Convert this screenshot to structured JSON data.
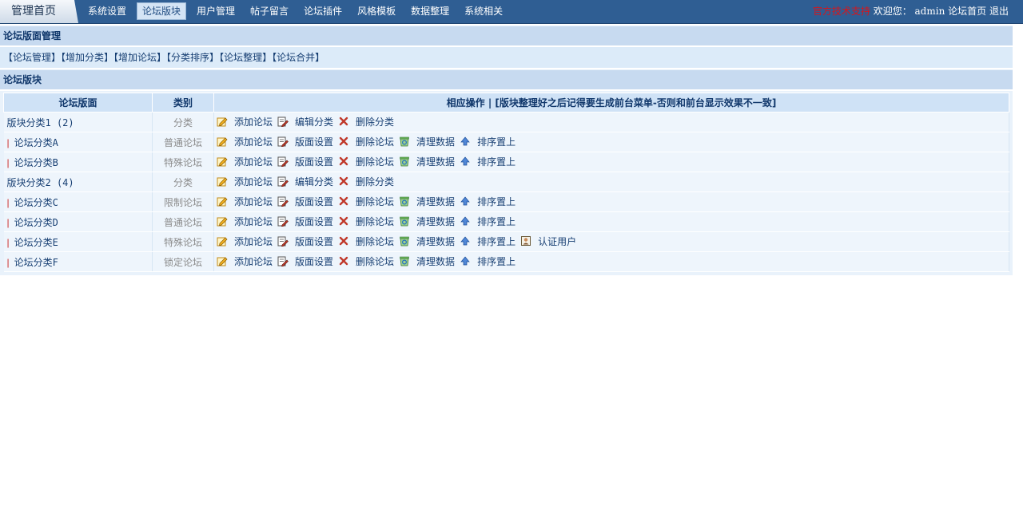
{
  "topbar": {
    "home": "管理首页",
    "nav": [
      "系统设置",
      "论坛版块",
      "用户管理",
      "帖子留言",
      "论坛插件",
      "风格模板",
      "数据整理",
      "系统相关"
    ],
    "active_index": 1,
    "support": "官方技术支持",
    "welcome": "欢迎您：",
    "user": "admin",
    "forum_home": "论坛首页",
    "logout": "退出"
  },
  "manage": {
    "title": "论坛版面管理",
    "links": [
      "【论坛管理】",
      "【增加分类】",
      "【增加论坛】",
      "【分类排序】",
      "【论坛整理】",
      "【论坛合并】"
    ]
  },
  "board": {
    "title": "论坛版块",
    "headers": {
      "name": "论坛版面",
      "type": "类别",
      "ops": "相应操作 | [版块整理好之后记得要生成前台菜单-否则和前台显示效果不一致]"
    },
    "rows": [
      {
        "name": "版块分类1 (2)",
        "is_child": false,
        "type": "分类",
        "ops": [
          {
            "icon": "edit-icon",
            "label": "添加论坛"
          },
          {
            "icon": "edit-doc-icon",
            "label": "编辑分类"
          },
          {
            "icon": "delete-icon",
            "label": "删除分类"
          }
        ]
      },
      {
        "name": "论坛分类A",
        "is_child": true,
        "type": "普通论坛",
        "ops": [
          {
            "icon": "edit-icon",
            "label": "添加论坛"
          },
          {
            "icon": "edit-doc-icon",
            "label": "版面设置"
          },
          {
            "icon": "delete-icon",
            "label": "删除论坛"
          },
          {
            "icon": "recycle-icon",
            "label": "清理数据"
          },
          {
            "icon": "arrow-up-icon",
            "label": "排序置上"
          }
        ]
      },
      {
        "name": "论坛分类B",
        "is_child": true,
        "type": "特殊论坛",
        "ops": [
          {
            "icon": "edit-icon",
            "label": "添加论坛"
          },
          {
            "icon": "edit-doc-icon",
            "label": "版面设置"
          },
          {
            "icon": "delete-icon",
            "label": "删除论坛"
          },
          {
            "icon": "recycle-icon",
            "label": "清理数据"
          },
          {
            "icon": "arrow-up-icon",
            "label": "排序置上"
          }
        ]
      },
      {
        "name": "版块分类2 (4)",
        "is_child": false,
        "type": "分类",
        "ops": [
          {
            "icon": "edit-icon",
            "label": "添加论坛"
          },
          {
            "icon": "edit-doc-icon",
            "label": "编辑分类"
          },
          {
            "icon": "delete-icon",
            "label": "删除分类"
          }
        ]
      },
      {
        "name": "论坛分类C",
        "is_child": true,
        "type": "限制论坛",
        "ops": [
          {
            "icon": "edit-icon",
            "label": "添加论坛"
          },
          {
            "icon": "edit-doc-icon",
            "label": "版面设置"
          },
          {
            "icon": "delete-icon",
            "label": "删除论坛"
          },
          {
            "icon": "recycle-icon",
            "label": "清理数据"
          },
          {
            "icon": "arrow-up-icon",
            "label": "排序置上"
          }
        ]
      },
      {
        "name": "论坛分类D",
        "is_child": true,
        "type": "普通论坛",
        "ops": [
          {
            "icon": "edit-icon",
            "label": "添加论坛"
          },
          {
            "icon": "edit-doc-icon",
            "label": "版面设置"
          },
          {
            "icon": "delete-icon",
            "label": "删除论坛"
          },
          {
            "icon": "recycle-icon",
            "label": "清理数据"
          },
          {
            "icon": "arrow-up-icon",
            "label": "排序置上"
          }
        ]
      },
      {
        "name": "论坛分类E",
        "is_child": true,
        "type": "特殊论坛",
        "ops": [
          {
            "icon": "edit-icon",
            "label": "添加论坛"
          },
          {
            "icon": "edit-doc-icon",
            "label": "版面设置"
          },
          {
            "icon": "delete-icon",
            "label": "删除论坛"
          },
          {
            "icon": "recycle-icon",
            "label": "清理数据"
          },
          {
            "icon": "arrow-up-icon",
            "label": "排序置上"
          },
          {
            "icon": "user-cert-icon",
            "label": "认证用户"
          }
        ]
      },
      {
        "name": "论坛分类F",
        "is_child": true,
        "type": "锁定论坛",
        "ops": [
          {
            "icon": "edit-icon",
            "label": "添加论坛"
          },
          {
            "icon": "edit-doc-icon",
            "label": "版面设置"
          },
          {
            "icon": "delete-icon",
            "label": "删除论坛"
          },
          {
            "icon": "recycle-icon",
            "label": "清理数据"
          },
          {
            "icon": "arrow-up-icon",
            "label": "排序置上"
          }
        ]
      }
    ]
  },
  "colors": {
    "topbar_bg": "#2f5e93",
    "header_bg": "#c7daf0",
    "row_bg": "#eef5fc",
    "support_red": "#d6161c"
  }
}
